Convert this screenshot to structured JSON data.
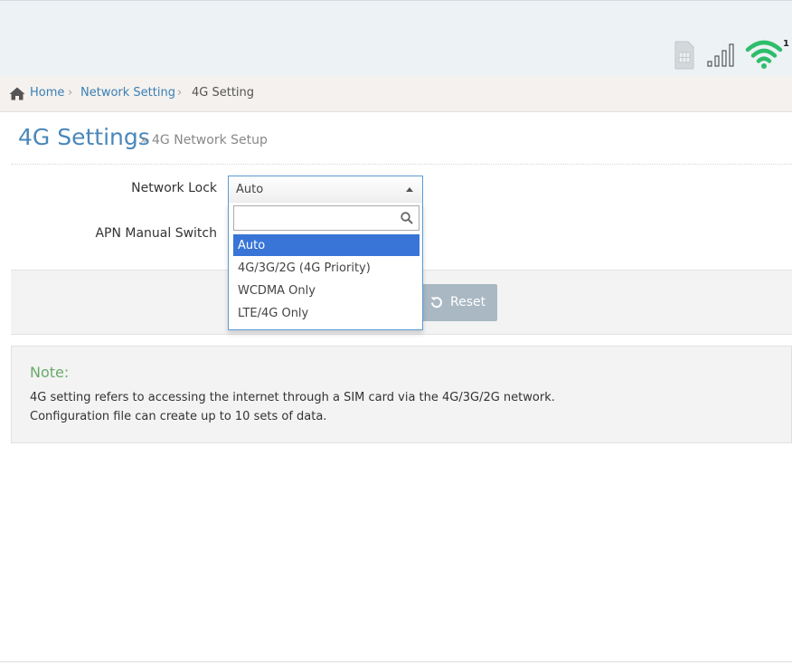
{
  "status": {
    "wifi_clients": "1"
  },
  "breadcrumb": {
    "home": "Home",
    "network_setting": "Network Setting",
    "current": "4G Setting"
  },
  "page": {
    "title": "4G Settings",
    "subtitle": "» 4G Network Setup"
  },
  "form": {
    "network_lock_label": "Network Lock",
    "network_lock_value": "Auto",
    "apn_switch_label": "APN Manual Switch",
    "search_placeholder": ""
  },
  "dropdown": {
    "options": [
      "Auto",
      "4G/3G/2G (4G Priority)",
      "WCDMA Only",
      "LTE/4G Only"
    ],
    "selected": "Auto"
  },
  "buttons": {
    "reset_label": "Reset"
  },
  "note": {
    "title": "Note:",
    "line1": "4G setting refers to accessing the internet through a SIM card via the 4G/3G/2G network.",
    "line2": "Configuration file can create up to 10 sets of data."
  },
  "colors": {
    "accent": "#4a87ba",
    "link": "#3a7fb5",
    "selected_option": "#3875d7",
    "wifi": "#2ebd6b",
    "note_title": "#6aaa6a",
    "reset_button": "#a9b8c2"
  }
}
